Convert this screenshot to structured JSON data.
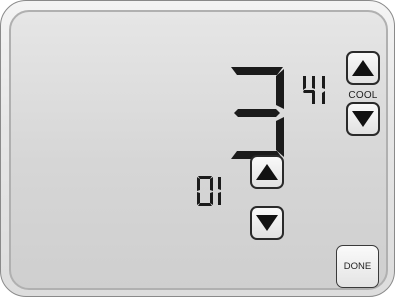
{
  "display": {
    "hour": "3",
    "minutes": "41",
    "day": "01"
  },
  "labels": {
    "mode": "COOL",
    "done": "DONE"
  },
  "icons": {
    "up": "up-arrow-icon",
    "down": "down-arrow-icon"
  },
  "colors": {
    "segment": "#1b1b1b",
    "panel": "#dcdcdc"
  }
}
